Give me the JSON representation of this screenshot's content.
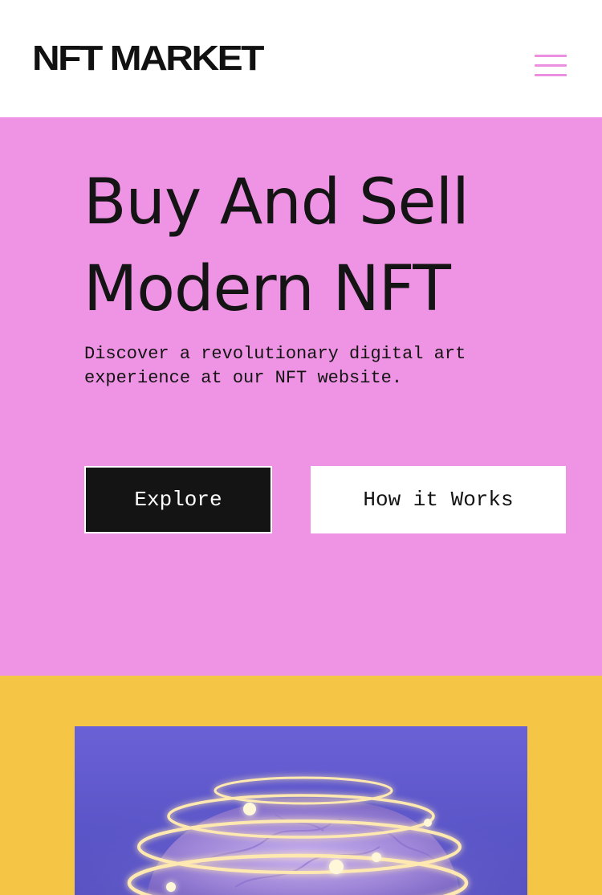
{
  "header": {
    "logo_text": "NFT MARKET",
    "menu_icon": "hamburger-menu-icon"
  },
  "hero": {
    "title_line1": "Buy And Sell",
    "title_line2": "Modern NFT",
    "description": "Discover a revolutionary digital art experience at our NFT website.",
    "primary_button": "Explore",
    "secondary_button": "How it Works"
  },
  "gallery": {
    "artwork_icon": "glowing-brain-artwork"
  },
  "colors": {
    "header_bg": "#ffffff",
    "hero_bg": "#ef94e4",
    "accent_pink": "#ec8fe0",
    "gallery_bg": "#f5c646",
    "primary_button_bg": "#141414",
    "artwork_bg": "#5a55c8"
  }
}
